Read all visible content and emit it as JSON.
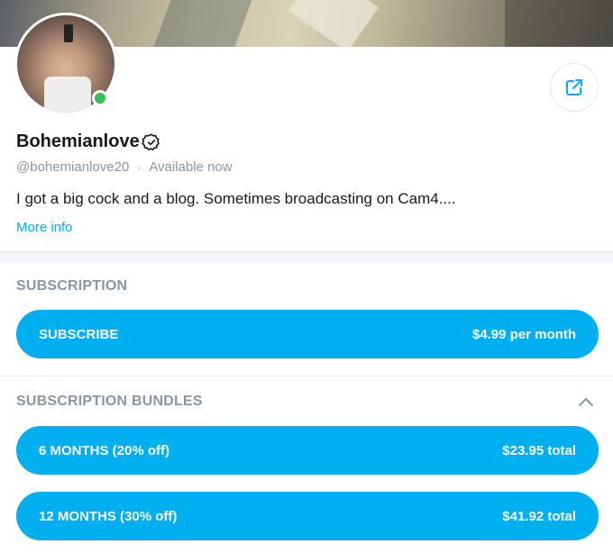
{
  "profile": {
    "name": "Bohemianlove",
    "handle": "@bohemianlove20",
    "separator": "·",
    "status": "Available now",
    "bio": "I got a big cock and a blog. Sometimes broadcasting on Cam4....",
    "more_info": "More info",
    "online": true
  },
  "subscription": {
    "title": "SUBSCRIPTION",
    "button_label": "SUBSCRIBE",
    "price": "$4.99 per month"
  },
  "bundles": {
    "title": "SUBSCRIPTION BUNDLES",
    "items": [
      {
        "label": "6 MONTHS (20% off)",
        "price": "$23.95 total"
      },
      {
        "label": "12 MONTHS (30% off)",
        "price": "$41.92 total"
      }
    ]
  },
  "colors": {
    "accent": "#00aff0",
    "muted": "#8a96a3",
    "online": "#36c05a"
  },
  "icons": {
    "share": "share-icon",
    "verified": "verified-badge-icon",
    "collapse": "chevron-up-icon"
  }
}
